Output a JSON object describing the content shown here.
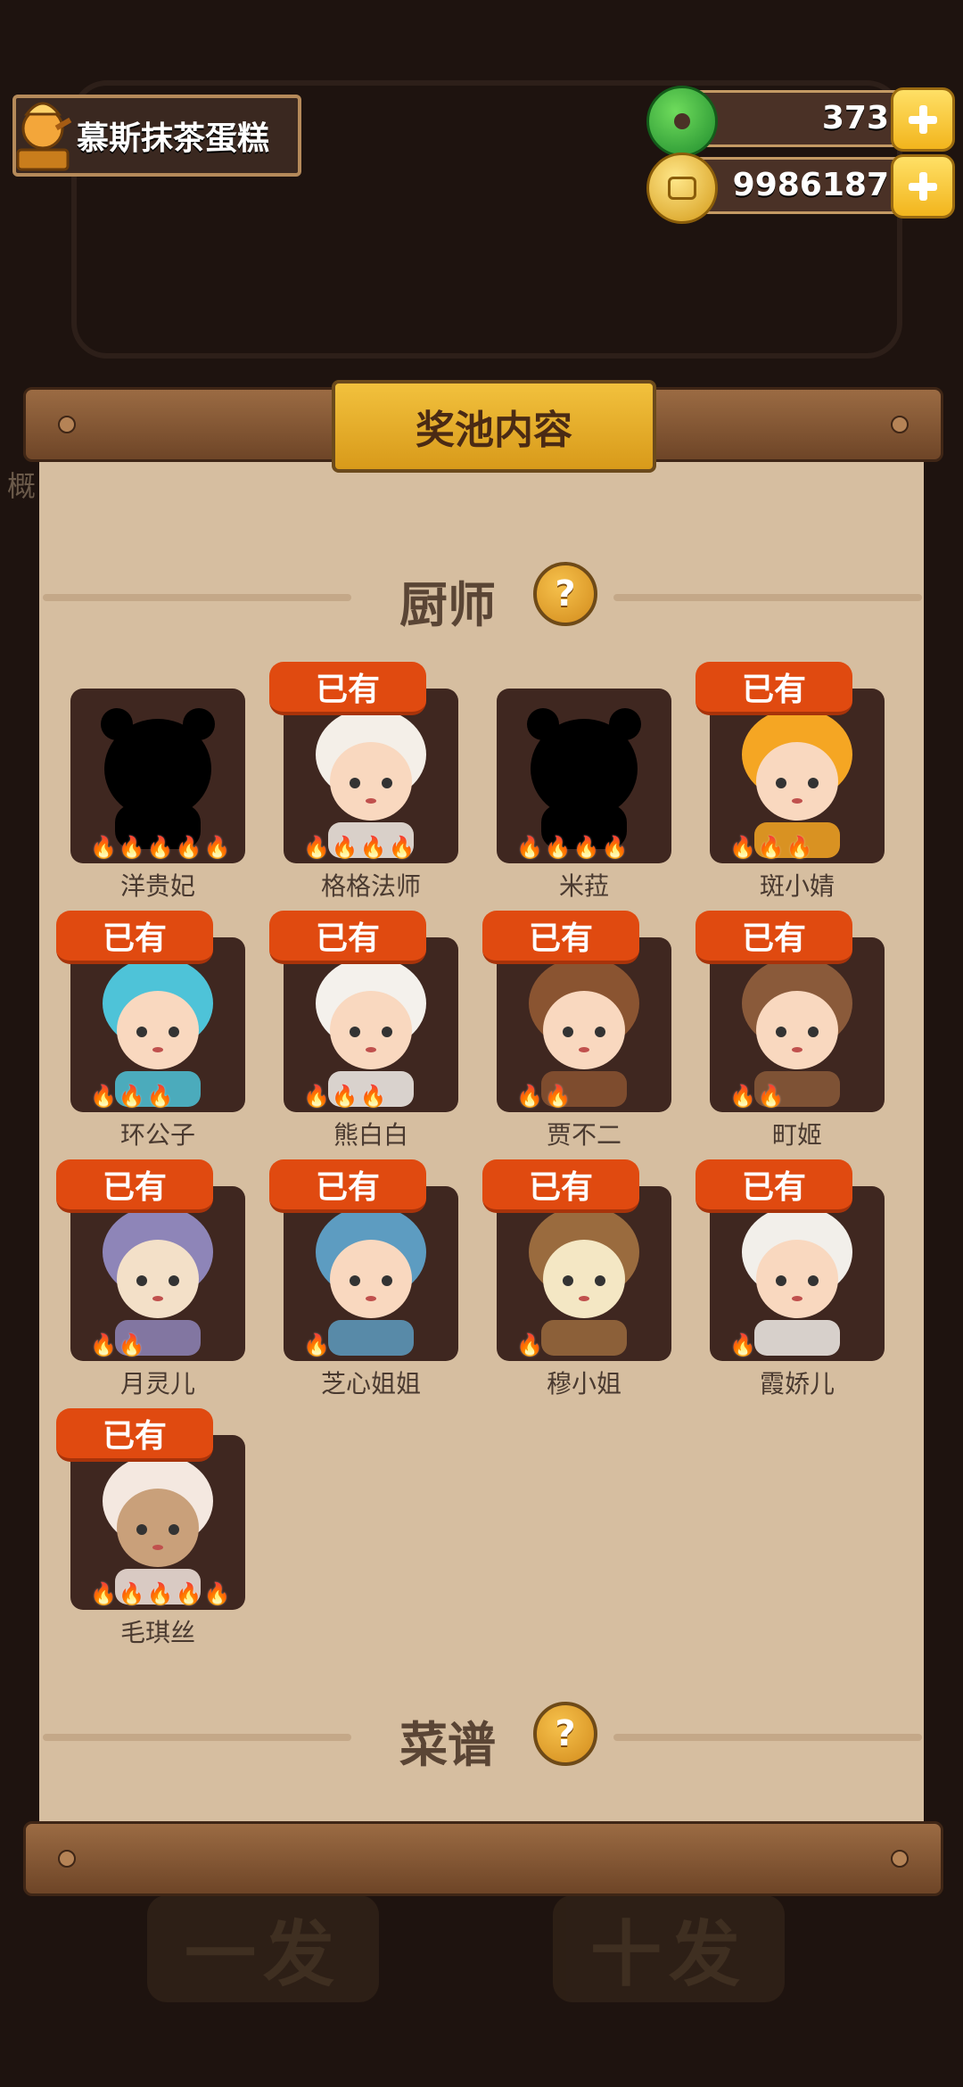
{
  "header": {
    "title": "慕斯抹茶蛋糕",
    "jade_amount": "373",
    "coin_amount": "9986187"
  },
  "panel": {
    "title": "奖池内容",
    "section_chef": "厨师",
    "section_recipe": "菜谱",
    "help_glyph": "?",
    "owned_label": "已有"
  },
  "background": {
    "left_label": "概",
    "btn_single": "一发",
    "btn_ten": "十发"
  },
  "chefs": [
    {
      "name": "洋贵妃",
      "stars": 5,
      "owned": false
    },
    {
      "name": "格格法师",
      "stars": 4,
      "owned": true
    },
    {
      "name": "米菈",
      "stars": 4,
      "owned": false
    },
    {
      "name": "斑小婧",
      "stars": 3,
      "owned": true
    },
    {
      "name": "环公子",
      "stars": 3,
      "owned": true
    },
    {
      "name": "熊白白",
      "stars": 3,
      "owned": true
    },
    {
      "name": "贾不二",
      "stars": 2,
      "owned": true
    },
    {
      "name": "町姬",
      "stars": 2,
      "owned": true
    },
    {
      "name": "月灵儿",
      "stars": 2,
      "owned": true
    },
    {
      "name": "芝心姐姐",
      "stars": 1,
      "owned": true
    },
    {
      "name": "穆小姐",
      "stars": 1,
      "owned": true
    },
    {
      "name": "霞娇儿",
      "stars": 1,
      "owned": true
    },
    {
      "name": "毛琪丝",
      "stars": 5,
      "owned": true
    }
  ],
  "colors": {
    "background": "#1e130f",
    "paper": "#d6bea0",
    "owned_badge": "#e04a10",
    "card": "#3f2720",
    "title_gold": "#f2c13d"
  }
}
